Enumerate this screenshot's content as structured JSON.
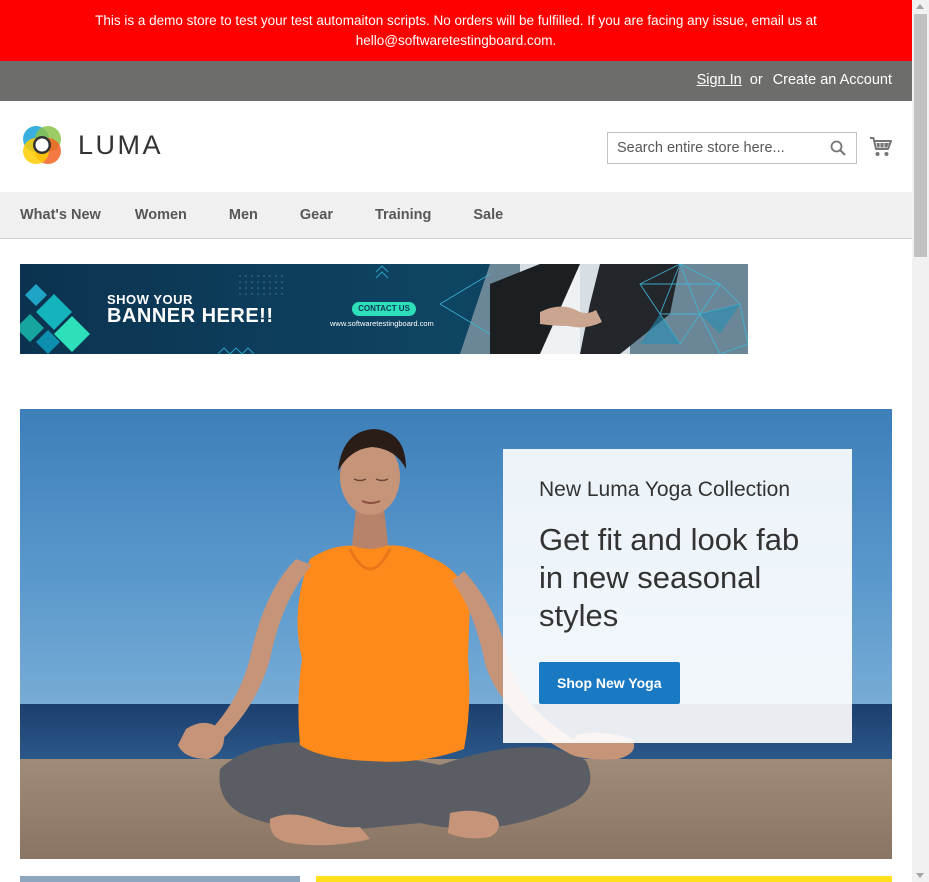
{
  "notice": {
    "line1": "This is a demo store to test your test automaiton scripts. No orders will be fulfilled. If you are facing any issue, email us at",
    "line2": "hello@softwaretestingboard.com."
  },
  "panel": {
    "sign_in": "Sign In",
    "or": "or",
    "create_account": "Create an Account"
  },
  "header": {
    "logo_text": "LUMA",
    "search_placeholder": "Search entire store here...",
    "search_icon": "search-icon",
    "cart_icon": "shopping-cart-icon"
  },
  "nav": {
    "items": [
      "What's New",
      "Women",
      "Men",
      "Gear",
      "Training",
      "Sale"
    ]
  },
  "promo": {
    "line1": "SHOW YOUR",
    "line2": "BANNER HERE!!",
    "cta": "CONTACT US",
    "url": "www.softwaretestingboard.com"
  },
  "hero": {
    "subtitle": "New Luma Yoga Collection",
    "headline": "Get fit and look fab in new seasonal styles",
    "button": "Shop New Yoga"
  },
  "colors": {
    "notice_bg": "#ff0000",
    "panel_bg": "#6d6d6c",
    "nav_bg": "#f0f0f0",
    "primary_button": "#1979c3",
    "promo_bg": "#0d3a56",
    "promo_accent": "#2de0b9"
  }
}
